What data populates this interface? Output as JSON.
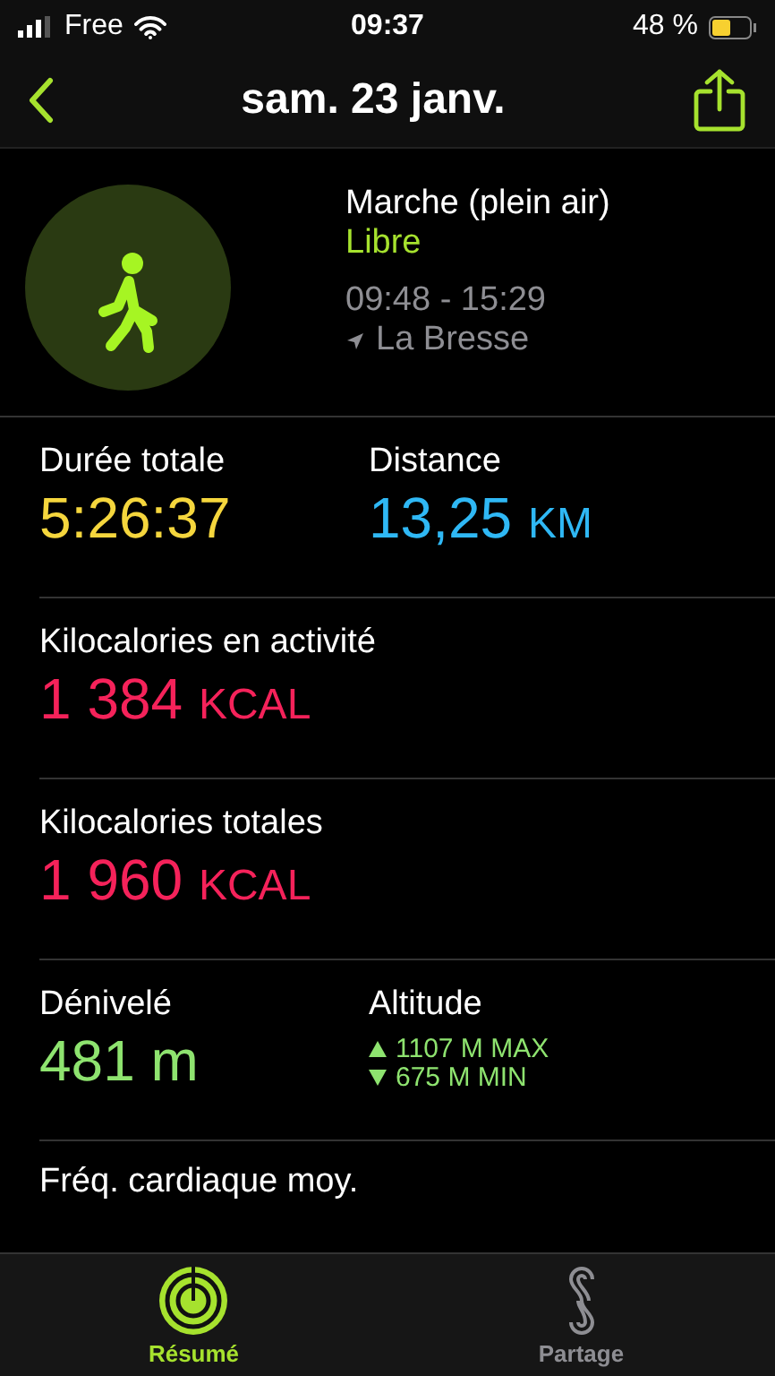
{
  "status_bar": {
    "carrier": "Free",
    "time": "09:37",
    "battery": "48 %"
  },
  "nav": {
    "title": "sam. 23 janv."
  },
  "workout": {
    "name": "Marche (plein air)",
    "goal": "Libre",
    "time_range": "09:48 - 15:29",
    "location": "La Bresse"
  },
  "rows": [
    {
      "cells": [
        {
          "kind": "value",
          "label": "Durée totale",
          "value": "5:26:37",
          "color": "#f5d63d"
        },
        {
          "kind": "value",
          "label": "Distance",
          "value": "13,25",
          "unit": "KM",
          "color": "#2fb8f5"
        }
      ]
    },
    {
      "cells": [
        {
          "kind": "value",
          "label": "Kilocalories en activité",
          "value": "1 384",
          "unit": "KCAL",
          "color": "#f5225a"
        }
      ]
    },
    {
      "cells": [
        {
          "kind": "value",
          "label": "Kilocalories totales",
          "value": "1 960",
          "unit": "KCAL",
          "color": "#f5225a"
        }
      ]
    },
    {
      "cells": [
        {
          "kind": "value",
          "label": "Dénivelé",
          "value": "481",
          "unit": "m",
          "color": "#8ee36f"
        },
        {
          "kind": "range",
          "label": "Altitude",
          "max": "1107 M MAX",
          "min": "675 M MIN",
          "color": "#8ee36f"
        }
      ]
    },
    {
      "cells": [
        {
          "kind": "label",
          "label": "Fréq. cardiaque moy."
        }
      ]
    }
  ],
  "tabs": [
    {
      "label": "Résumé",
      "selected": true,
      "kind": "rings"
    },
    {
      "label": "Partage",
      "selected": false,
      "kind": "share"
    }
  ]
}
